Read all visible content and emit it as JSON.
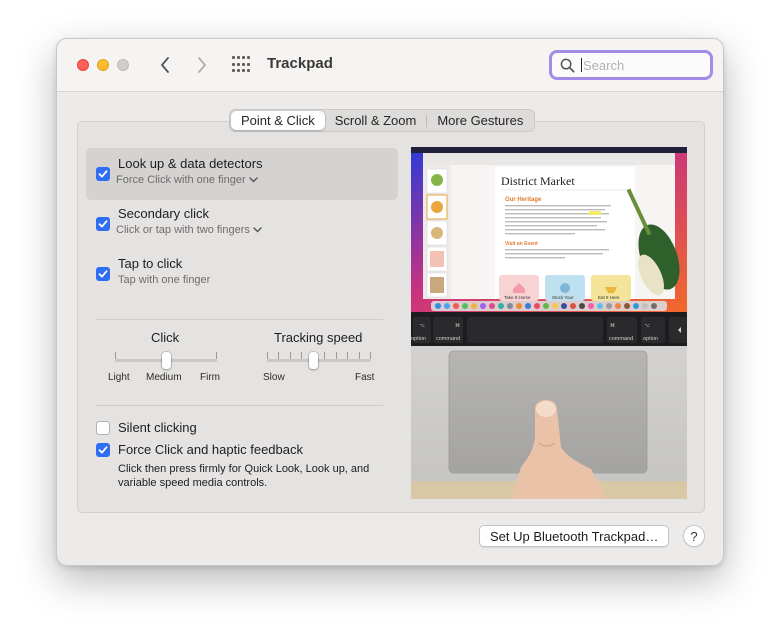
{
  "window": {
    "title": "Trackpad",
    "search_placeholder": "Search"
  },
  "tabs": [
    {
      "label": "Point & Click",
      "active": true
    },
    {
      "label": "Scroll & Zoom",
      "active": false
    },
    {
      "label": "More Gestures",
      "active": false
    }
  ],
  "options": [
    {
      "label": "Look up & data detectors",
      "sub": "Force Click with one finger",
      "checked": true,
      "has_dropdown": true,
      "selected": true
    },
    {
      "label": "Secondary click",
      "sub": "Click or tap with two fingers",
      "checked": true,
      "has_dropdown": true,
      "selected": false
    },
    {
      "label": "Tap to click",
      "sub": "Tap with one finger",
      "checked": true,
      "has_dropdown": false,
      "selected": false
    }
  ],
  "sliders": {
    "click": {
      "title": "Click",
      "labels": [
        "Light",
        "Medium",
        "Firm"
      ],
      "value": "Medium"
    },
    "tracking": {
      "title": "Tracking speed",
      "min_label": "Slow",
      "max_label": "Fast",
      "level": 0.4
    }
  },
  "bottom_options": [
    {
      "label": "Silent clicking",
      "checked": false
    },
    {
      "label": "Force Click and haptic feedback",
      "checked": true
    }
  ],
  "force_click_description": "Click then press firmly for Quick Look, Look up, and variable speed media controls.",
  "preview": {
    "doc_title": "District Market",
    "heading": "Our Heritage",
    "subheading": "Visit an Event",
    "cards": [
      "Take It Home",
      "Stock Your",
      "Eat It Here"
    ],
    "keys": {
      "left_option": "option",
      "left_command": "command",
      "right_command": "command",
      "right_option": "option",
      "cmd_symbol": "⌘",
      "alt_symbol": "⌥"
    }
  },
  "buttons": {
    "bluetooth": "Set Up Bluetooth Trackpad…",
    "help": "?"
  },
  "colors": {
    "accent": "#2f6ef2",
    "search_focus": "#a48ce6",
    "heading_orange": "#e07a2f"
  }
}
